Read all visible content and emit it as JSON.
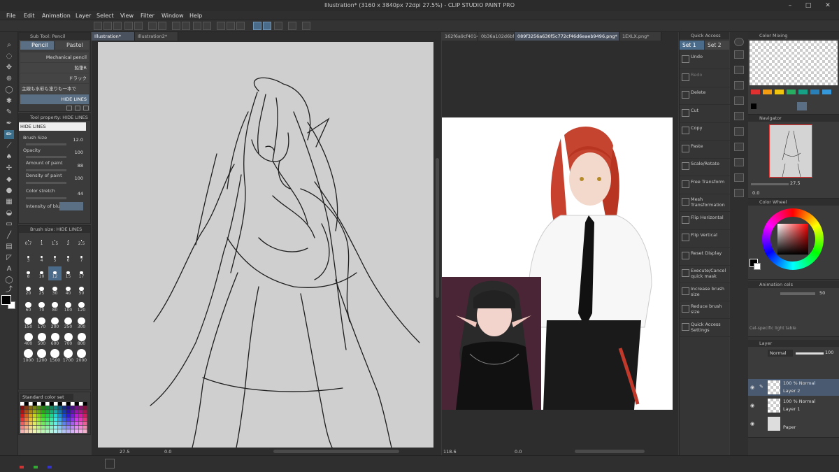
{
  "app": {
    "title": "Illustration* (3160 x 3840px 72dpi 27.5%) - CLIP STUDIO PAINT PRO"
  },
  "menu": [
    "File",
    "Edit",
    "Animation",
    "Layer",
    "Select",
    "View",
    "Filter",
    "Window",
    "Help"
  ],
  "subtool": {
    "header": "Sub Tool: Pencil",
    "tabs": [
      "Pencil",
      "Pastel"
    ],
    "brushes": [
      "Mechanical pencil",
      "鉛筆R",
      "ドラック",
      "主線も水彩も塗りも一本で",
      "HIDE LINES"
    ],
    "selected_index": 4
  },
  "tool_property": {
    "header": "Tool property: HIDE LINES",
    "name": "HIDE LINES",
    "rows": [
      {
        "label": "Brush Size",
        "value": "12.0"
      },
      {
        "label": "Opacity",
        "value": "100"
      },
      {
        "label": "Amount of paint",
        "value": "88"
      },
      {
        "label": "Density of paint",
        "value": "100"
      },
      {
        "label": "Color stretch",
        "value": "44"
      },
      {
        "label": "Intensity of blur",
        "value": ""
      }
    ]
  },
  "brush_size": {
    "header": "Brush size: HIDE LINES",
    "sizes": [
      "0.7",
      "1",
      "1.5",
      "2",
      "2.5",
      "3",
      "4",
      "5",
      "6",
      "7",
      "8",
      "10",
      "12",
      "15",
      "17",
      "20",
      "25",
      "30",
      "40",
      "50",
      "60",
      "70",
      "80",
      "100",
      "120",
      "150",
      "170",
      "200",
      "250",
      "300",
      "400",
      "500",
      "600",
      "700",
      "800",
      "1000",
      "1200",
      "1500",
      "1700",
      "2000"
    ],
    "selected": "12"
  },
  "color_set": {
    "label": "Standard color set"
  },
  "documents": {
    "tabs_left": [
      "Illustration*",
      "Illustration2*"
    ],
    "tabs_right": [
      "162f6a9cf4014...",
      "0b36a102d6bf...",
      "089f3256a630f5c772cf46d6eaeb9496.png*",
      "1EXLX.png*"
    ]
  },
  "status_left": {
    "zoom": "27.5",
    "angle": "0.0"
  },
  "status_right": {
    "zoom": "118.6",
    "angle": "0.0"
  },
  "quick_access": {
    "header": "Quick Access",
    "sets": [
      "Set 1",
      "Set 2"
    ],
    "items": [
      "Undo",
      "Redo",
      "Delete",
      "Cut",
      "Copy",
      "Paste",
      "Scale/Rotate",
      "Free Transform",
      "Mesh Transformation",
      "Flip Horizontal",
      "Flip Vertical",
      "Reset Display",
      "Execute/Cancel quick mask",
      "Increase brush size",
      "Reduce brush size",
      "Quick Access Settings"
    ]
  },
  "color_mixing": {
    "header": "Color Mixing"
  },
  "navigator": {
    "header": "Navigator",
    "zoom": "27.5",
    "angle": "0.0"
  },
  "color_wheel": {
    "header": "Color Wheel"
  },
  "animation_cels": {
    "header": "Animation cels",
    "value": "50",
    "footer": "Cel-specific light table"
  },
  "layer_panel": {
    "header": "Layer",
    "blend": "Normal",
    "opacity": "100",
    "layers": [
      {
        "mode": "100 % Normal",
        "name": "Layer 2",
        "selected": true
      },
      {
        "mode": "100 % Normal",
        "name": "Layer 1",
        "selected": false
      },
      {
        "mode": "",
        "name": "Paper",
        "selected": false
      }
    ]
  },
  "colors": {
    "accent": "#4a6b8a",
    "canvas_gray": "#cfcfcf",
    "app_bg": "#3a3a3a"
  }
}
